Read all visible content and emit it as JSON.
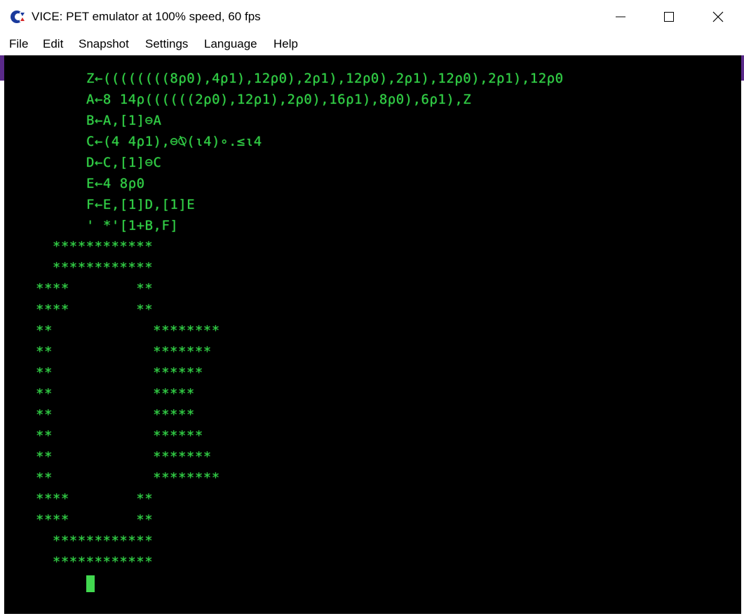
{
  "window": {
    "title": "VICE: PET emulator at 100% speed, 60 fps",
    "controls": {
      "minimize": "minimize-icon",
      "maximize": "maximize-icon",
      "close": "close-icon"
    }
  },
  "menu": {
    "file": "File",
    "edit": "Edit",
    "snapshot": "Snapshot",
    "settings": "Settings",
    "language": "Language",
    "help": "Help"
  },
  "screen": {
    "text_color": "#31d046",
    "background": "#000000",
    "lines": [
      "Z←((((((((8⍴0),4⍴1),12⍴0),2⍴1),12⍴0),2⍴1),12⍴0),2⍴1),12⍴0",
      "A←8 14⍴((((((2⍴0),12⍴1),2⍴0),16⍴1),8⍴0),6⍴1),Z",
      "B←A,[1]⊖A",
      "C←(4 4⍴1),⊖⍉(ι4)∘.≤ι4",
      "D←C,[1]⊖C",
      "E←4 8⍴0",
      "F←E,[1]D,[1]E",
      "' *'[1+B,F]",
      "  ************",
      "  ************",
      "****        **",
      "****        **",
      "**            ********",
      "**            *******",
      "**            ******",
      "**            *****",
      "**            *****",
      "**            ******",
      "**            *******",
      "**            ********",
      "****        **",
      "****        **",
      "  ************",
      "  ************"
    ]
  }
}
